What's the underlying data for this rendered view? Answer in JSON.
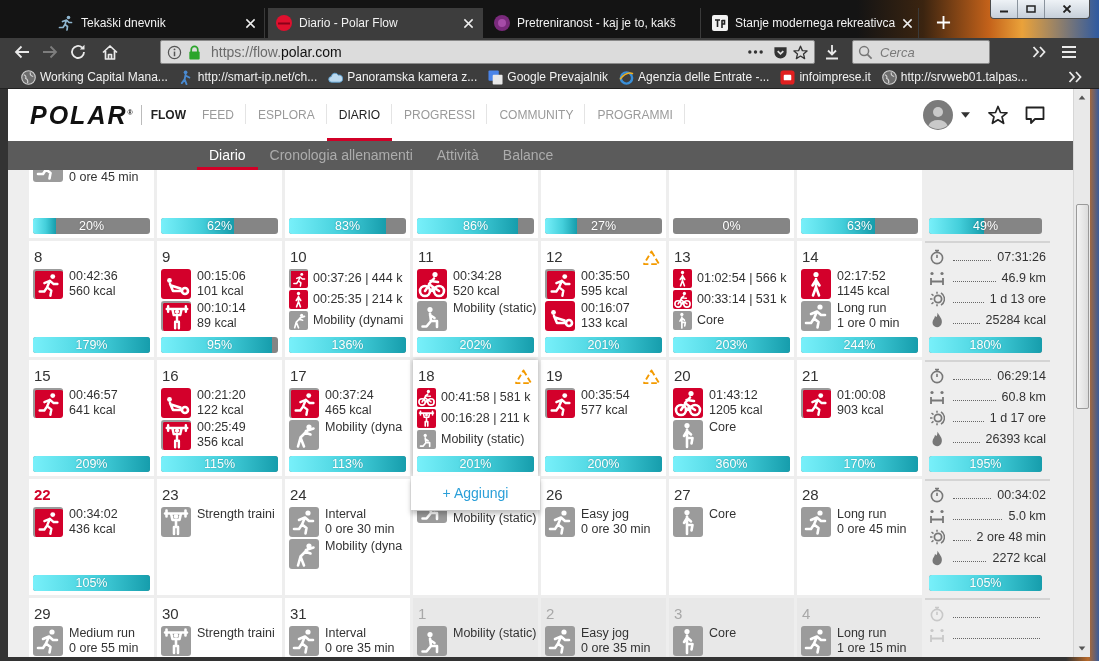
{
  "browser": {
    "tabs": [
      {
        "title": "Tekaški dnevnik",
        "selected": false,
        "closable": true
      },
      {
        "title": "Diario - Polar Flow",
        "selected": true,
        "closable": true
      },
      {
        "title": "Pretreniranost - kaj je to, kakš",
        "selected": false,
        "closable": false
      },
      {
        "title": "Stanje modernega rekreativca",
        "selected": false,
        "closable": true
      }
    ],
    "back_disabled": false,
    "forward_disabled": true,
    "url": {
      "prefix": "https://flow.",
      "domain": "polar.com"
    },
    "search": {
      "placeholder": "Cerca"
    },
    "bookmarks": [
      "Working Capital Mana...",
      "http://smart-ip.net/ch...",
      "Panoramska kamera z...",
      "Google Prevajalnik",
      "Agenzia delle Entrate -...",
      "infoimprese.it",
      "http://srvweb01.talpas..."
    ]
  },
  "header": {
    "logo": "POLAR$^{®}$",
    "product": "FLOW",
    "nav": [
      {
        "label": "FEED",
        "selected": false
      },
      {
        "label": "ESPLORA",
        "selected": false
      },
      {
        "label": "DIARIO",
        "selected": true
      },
      {
        "label": "PROGRESSI",
        "selected": false
      },
      {
        "label": "COMMUNITY",
        "selected": false
      },
      {
        "label": "PROGRAMMI",
        "selected": false
      }
    ]
  },
  "subnav": [
    {
      "label": "Diario",
      "selected": true
    },
    {
      "label": "Cronologia allenamenti",
      "selected": false
    },
    {
      "label": "Attività",
      "selected": false
    },
    {
      "label": "Balance",
      "selected": false
    }
  ],
  "calendar": {
    "weeks": [
      {
        "days": [
          {
            "entries": [
              {
                "kind": "run",
                "done": false,
                "planned": true,
                "lines": [
                  "0 ore 45 min"
                ]
              }
            ],
            "bar": {
              "label": "20%",
              "level": 0.2
            }
          },
          {
            "bar": {
              "label": "62%",
              "level": 0.62
            }
          },
          {
            "bar": {
              "label": "83%",
              "level": 0.83
            }
          },
          {
            "bar": {
              "label": "86%",
              "level": 0.86
            }
          },
          {
            "bar": {
              "label": "27%",
              "level": 0.27
            }
          },
          {
            "bar": {
              "label": "0%",
              "level": 0
            }
          },
          {
            "bar": {
              "label": "63%",
              "level": 0.63
            }
          }
        ],
        "summary": {
          "bar": {
            "label": "49%",
            "level": 0.49
          }
        }
      },
      {
        "days": [
          {
            "date": "8",
            "today": false,
            "outside": false,
            "alert": false,
            "expanded": false,
            "entries": [
              {
                "kind": "run",
                "done": true,
                "planned": true,
                "lines": [
                  "00:42:36",
                  "560 kcal"
                ]
              }
            ],
            "bar": {
              "label": "179%",
              "level": 1
            }
          },
          {
            "date": "9",
            "today": false,
            "outside": false,
            "alert": false,
            "expanded": false,
            "entries": [
              {
                "kind": "sit",
                "done": true,
                "planned": false,
                "lines": [
                  "00:15:06",
                  "101 kcal"
                ]
              },
              {
                "kind": "weights",
                "done": true,
                "planned": true,
                "lines": [
                  "00:10:14",
                  "89 kcal"
                ]
              }
            ],
            "bar": {
              "label": "95%",
              "level": 0.95
            }
          },
          {
            "date": "10",
            "today": false,
            "outside": false,
            "alert": false,
            "expanded": false,
            "entries": [
              {
                "kind": "run",
                "done": true,
                "planned": true,
                "lines": [
                  "00:37:26 | 444 k"
                ]
              },
              {
                "kind": "walk",
                "done": true,
                "planned": false,
                "lines": [
                  "00:25:35 | 214 k"
                ]
              },
              {
                "kind": "stretch",
                "done": false,
                "planned": true,
                "lines": [
                  "Mobility (dynami"
                ]
              }
            ],
            "bar": {
              "label": "136%",
              "level": 1
            }
          },
          {
            "date": "11",
            "today": false,
            "outside": false,
            "alert": false,
            "expanded": false,
            "entries": [
              {
                "kind": "bike",
                "done": true,
                "planned": false,
                "lines": [
                  "00:34:28",
                  "520 kcal"
                ]
              },
              {
                "kind": "lunge",
                "done": false,
                "planned": true,
                "lines": [
                  "Mobility (static)"
                ]
              }
            ],
            "bar": {
              "label": "202%",
              "level": 1
            }
          },
          {
            "date": "12",
            "today": false,
            "outside": false,
            "alert": true,
            "expanded": false,
            "entries": [
              {
                "kind": "run",
                "done": true,
                "planned": true,
                "lines": [
                  "00:35:50",
                  "595 kcal"
                ]
              },
              {
                "kind": "sit",
                "done": true,
                "planned": false,
                "lines": [
                  "00:16:07",
                  "133 kcal"
                ]
              }
            ],
            "bar": {
              "label": "201%",
              "level": 1
            }
          },
          {
            "date": "13",
            "today": false,
            "outside": false,
            "alert": false,
            "expanded": false,
            "entries": [
              {
                "kind": "walk",
                "done": true,
                "planned": false,
                "lines": [
                  "01:02:54 | 566 k"
                ]
              },
              {
                "kind": "bike",
                "done": true,
                "planned": false,
                "lines": [
                  "00:33:14 | 531 k"
                ]
              },
              {
                "kind": "core",
                "done": false,
                "planned": true,
                "lines": [
                  "Core"
                ]
              }
            ],
            "bar": {
              "label": "203%",
              "level": 1
            }
          },
          {
            "date": "14",
            "today": false,
            "outside": false,
            "alert": false,
            "expanded": false,
            "entries": [
              {
                "kind": "walk",
                "done": true,
                "planned": false,
                "lines": [
                  "02:17:52",
                  "1145 kcal"
                ]
              },
              {
                "kind": "run",
                "done": false,
                "planned": true,
                "lines": [
                  "Long run",
                  "1 ore 0 min"
                ]
              }
            ],
            "bar": {
              "label": "244%",
              "level": 1
            }
          }
        ],
        "summary": {
          "stats": [
            {
              "kind": "time",
              "value": "07:31:26"
            },
            {
              "kind": "distance",
              "value": "46.9 km"
            },
            {
              "kind": "load",
              "value": "1 d 13 ore"
            },
            {
              "kind": "calories",
              "value": "25284 kcal"
            }
          ],
          "bar": {
            "label": "180%",
            "level": 1
          }
        }
      },
      {
        "days": [
          {
            "date": "15",
            "today": false,
            "outside": false,
            "alert": false,
            "expanded": false,
            "entries": [
              {
                "kind": "run",
                "done": true,
                "planned": true,
                "lines": [
                  "00:46:57",
                  "641 kcal"
                ]
              }
            ],
            "bar": {
              "label": "209%",
              "level": 1
            }
          },
          {
            "date": "16",
            "today": false,
            "outside": false,
            "alert": false,
            "expanded": false,
            "entries": [
              {
                "kind": "sit",
                "done": true,
                "planned": false,
                "lines": [
                  "00:21:20",
                  "122 kcal"
                ]
              },
              {
                "kind": "weights",
                "done": true,
                "planned": true,
                "lines": [
                  "00:25:49",
                  "356 kcal"
                ]
              }
            ],
            "bar": {
              "label": "115%",
              "level": 1
            }
          },
          {
            "date": "17",
            "today": false,
            "outside": false,
            "alert": false,
            "expanded": false,
            "entries": [
              {
                "kind": "run",
                "done": true,
                "planned": true,
                "lines": [
                  "00:37:24",
                  "465 kcal"
                ]
              },
              {
                "kind": "stretch",
                "done": false,
                "planned": true,
                "lines": [
                  "Mobility (dyna"
                ]
              }
            ],
            "bar": {
              "label": "113%",
              "level": 1
            }
          },
          {
            "date": "18",
            "today": false,
            "outside": false,
            "alert": true,
            "expanded": true,
            "add_label": "+ Aggiungi",
            "entries": [
              {
                "kind": "bike",
                "done": true,
                "planned": false,
                "lines": [
                  "00:41:58 | 581 k"
                ]
              },
              {
                "kind": "weights",
                "done": true,
                "planned": false,
                "lines": [
                  "00:16:28 | 211 k"
                ]
              },
              {
                "kind": "lunge",
                "done": false,
                "planned": true,
                "lines": [
                  "Mobility (static)"
                ]
              }
            ],
            "bar": {
              "label": "201%",
              "level": 1
            }
          },
          {
            "date": "19",
            "today": false,
            "outside": false,
            "alert": true,
            "expanded": false,
            "entries": [
              {
                "kind": "run",
                "done": true,
                "planned": true,
                "lines": [
                  "00:35:54",
                  "577 kcal"
                ]
              }
            ],
            "bar": {
              "label": "200%",
              "level": 1
            }
          },
          {
            "date": "20",
            "today": false,
            "outside": false,
            "alert": false,
            "expanded": false,
            "entries": [
              {
                "kind": "bike",
                "done": true,
                "planned": false,
                "lines": [
                  "01:43:12",
                  "1205 kcal"
                ]
              },
              {
                "kind": "core",
                "done": false,
                "planned": true,
                "lines": [
                  "Core"
                ]
              }
            ],
            "bar": {
              "label": "360%",
              "level": 1
            }
          },
          {
            "date": "21",
            "today": false,
            "outside": false,
            "alert": false,
            "expanded": false,
            "entries": [
              {
                "kind": "run",
                "done": true,
                "planned": true,
                "lines": [
                  "01:00:08",
                  "903 kcal"
                ]
              }
            ],
            "bar": {
              "label": "170%",
              "level": 1
            }
          }
        ],
        "summary": {
          "stats": [
            {
              "kind": "time",
              "value": "06:29:14"
            },
            {
              "kind": "distance",
              "value": "60.8 km"
            },
            {
              "kind": "load",
              "value": "1 d 17 ore"
            },
            {
              "kind": "calories",
              "value": "26393 kcal"
            }
          ],
          "bar": {
            "label": "195%",
            "level": 1
          }
        }
      },
      {
        "days": [
          {
            "date": "22",
            "today": true,
            "outside": false,
            "alert": false,
            "expanded": false,
            "entries": [
              {
                "kind": "run",
                "done": true,
                "planned": true,
                "lines": [
                  "00:34:02",
                  "436 kcal"
                ]
              }
            ],
            "bar": {
              "label": "105%",
              "level": 1
            }
          },
          {
            "date": "23",
            "today": false,
            "outside": false,
            "alert": false,
            "expanded": false,
            "entries": [
              {
                "kind": "weights",
                "done": false,
                "planned": true,
                "lines": [
                  "Strength traini"
                ]
              }
            ]
          },
          {
            "date": "24",
            "today": false,
            "outside": false,
            "alert": false,
            "expanded": false,
            "entries": [
              {
                "kind": "run",
                "done": false,
                "planned": true,
                "lines": [
                  "Interval",
                  "0 ore 30 min"
                ]
              },
              {
                "kind": "stretch",
                "done": false,
                "planned": true,
                "lines": [
                  "Mobility (dyna"
                ]
              }
            ]
          },
          {
            "entries": [
              {
                "kind": "lunge",
                "done": false,
                "planned": true,
                "lines": [
                  "Mobility (static)"
                ]
              }
            ]
          },
          {
            "date": "26",
            "today": false,
            "outside": false,
            "alert": false,
            "expanded": false,
            "entries": [
              {
                "kind": "run",
                "done": false,
                "planned": true,
                "lines": [
                  "Easy jog",
                  "0 ore 30 min"
                ]
              }
            ]
          },
          {
            "date": "27",
            "today": false,
            "outside": false,
            "alert": false,
            "expanded": false,
            "entries": [
              {
                "kind": "core",
                "done": false,
                "planned": true,
                "lines": [
                  "Core"
                ]
              }
            ]
          },
          {
            "date": "28",
            "today": false,
            "outside": false,
            "alert": false,
            "expanded": false,
            "entries": [
              {
                "kind": "run",
                "done": false,
                "planned": true,
                "lines": [
                  "Long run",
                  "0 ore 45 min"
                ]
              }
            ]
          }
        ],
        "summary": {
          "stats": [
            {
              "kind": "time",
              "value": "00:34:02"
            },
            {
              "kind": "distance",
              "value": "5.0 km"
            },
            {
              "kind": "load",
              "value": "2 ore 48 min"
            },
            {
              "kind": "calories",
              "value": "2272 kcal"
            }
          ],
          "bar": {
            "label": "105%",
            "level": 1
          }
        }
      },
      {
        "days": [
          {
            "date": "29",
            "today": false,
            "outside": false,
            "alert": false,
            "expanded": false,
            "entries": [
              {
                "kind": "run",
                "done": false,
                "planned": true,
                "lines": [
                  "Medium run",
                  "0 ore 55 min"
                ]
              }
            ]
          },
          {
            "date": "30",
            "today": false,
            "outside": false,
            "alert": false,
            "expanded": false,
            "entries": [
              {
                "kind": "weights",
                "done": false,
                "planned": true,
                "lines": [
                  "Strength traini"
                ]
              }
            ]
          },
          {
            "date": "31",
            "today": false,
            "outside": false,
            "alert": false,
            "expanded": false,
            "entries": [
              {
                "kind": "run",
                "done": false,
                "planned": true,
                "lines": [
                  "Interval",
                  "0 ore 35 min"
                ]
              }
            ]
          },
          {
            "date": "1",
            "today": false,
            "outside": true,
            "alert": false,
            "expanded": false,
            "entries": [
              {
                "kind": "lunge",
                "done": false,
                "planned": true,
                "lines": [
                  "Mobility (static)"
                ]
              }
            ]
          },
          {
            "date": "2",
            "today": false,
            "outside": true,
            "alert": false,
            "expanded": false,
            "entries": [
              {
                "kind": "run",
                "done": false,
                "planned": true,
                "lines": [
                  "Easy jog",
                  "0 ore 35 min"
                ]
              }
            ]
          },
          {
            "date": "3",
            "today": false,
            "outside": true,
            "alert": false,
            "expanded": false,
            "entries": [
              {
                "kind": "core",
                "done": false,
                "planned": true,
                "lines": [
                  "Core"
                ]
              }
            ]
          },
          {
            "date": "4",
            "today": false,
            "outside": true,
            "alert": false,
            "expanded": false,
            "entries": [
              {
                "kind": "run",
                "done": false,
                "planned": true,
                "lines": [
                  "Long run",
                  "1 ore 15 min"
                ]
              }
            ]
          }
        ],
        "summary": {
          "stats": [
            {
              "kind": "time"
            },
            {
              "kind": "distance"
            }
          ]
        }
      }
    ]
  }
}
